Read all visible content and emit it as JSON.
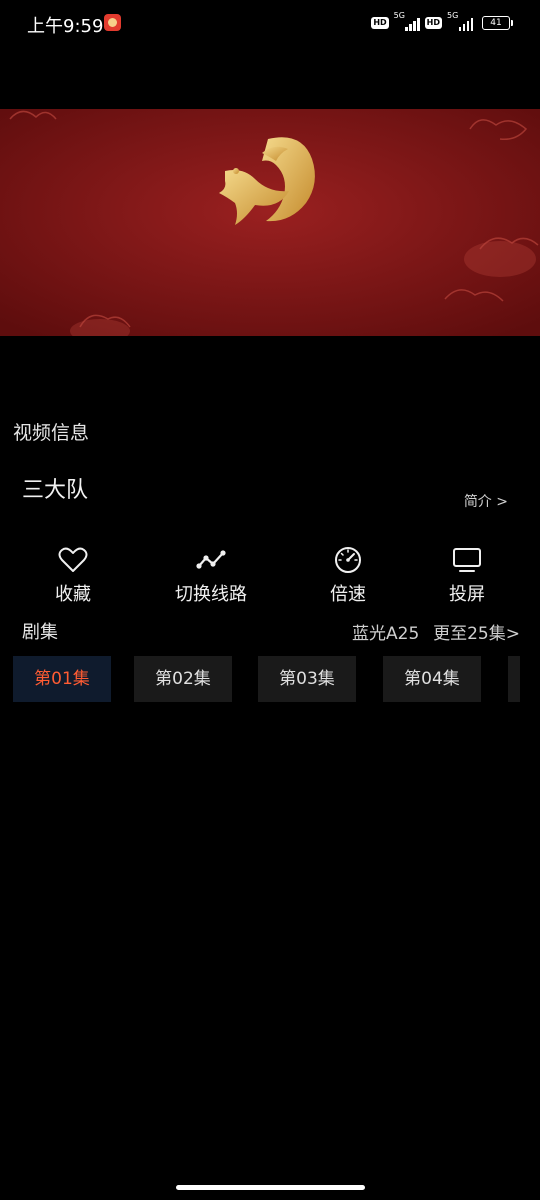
{
  "status": {
    "time": "上午9:59",
    "hd": "HD",
    "network": "5G",
    "battery": "41"
  },
  "section": {
    "title": "视频信息"
  },
  "video": {
    "title": "三大队",
    "intro_label": "简介 >"
  },
  "actions": [
    {
      "label": "收藏",
      "icon": "heart-icon"
    },
    {
      "label": "切换线路",
      "icon": "route-icon"
    },
    {
      "label": "倍速",
      "icon": "speedometer-icon"
    },
    {
      "label": "投屏",
      "icon": "tv-cast-icon"
    }
  ],
  "episodes": {
    "header": "剧集",
    "source": "蓝光A25",
    "more": "更至25集>",
    "items": [
      "第01集",
      "第02集",
      "第03集",
      "第04集"
    ],
    "active_index": 0,
    "active_color": "#ff5c33"
  },
  "colors": {
    "banner_red": "#8a1a1a",
    "banner_gold": "#e8c36a"
  }
}
